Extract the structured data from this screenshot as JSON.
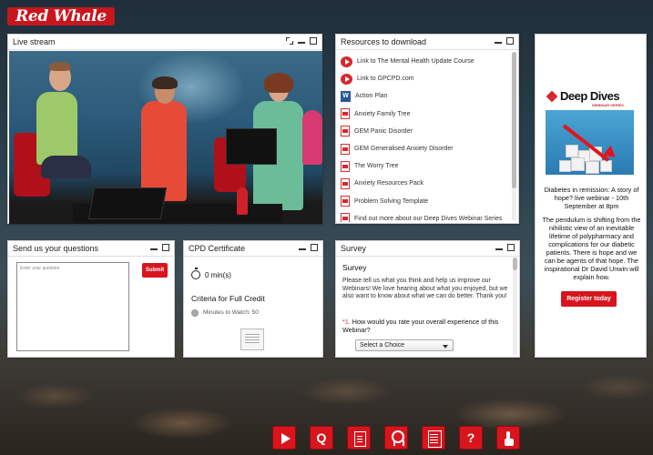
{
  "brand": {
    "logo_text": "Red Whale"
  },
  "live_stream": {
    "title": "Live stream"
  },
  "resources": {
    "title": "Resources to download",
    "items": [
      {
        "label": "Link to The Mental Health Update Course",
        "icon": "video-link-icon"
      },
      {
        "label": "Link to GPCPD.com",
        "icon": "video-link-icon"
      },
      {
        "label": "Action Plan",
        "icon": "word-doc-icon"
      },
      {
        "label": "Anxiety Family Tree",
        "icon": "pdf-icon"
      },
      {
        "label": "GEM Panic Disorder",
        "icon": "pdf-icon"
      },
      {
        "label": "GEM Generalised Anxiety Disorder",
        "icon": "pdf-icon"
      },
      {
        "label": "The Worry Tree",
        "icon": "pdf-icon"
      },
      {
        "label": "Anxiety Resources Pack",
        "icon": "pdf-icon"
      },
      {
        "label": "Problem Solving Template",
        "icon": "pdf-icon"
      },
      {
        "label": "Find out more about our Deep Dives Webinar Series",
        "icon": "pdf-icon"
      }
    ]
  },
  "ad": {
    "logo_text": "Deep Dives",
    "logo_sub": "WEBINAR SERIES",
    "title": "Diabetes in remission: A story of hope? live webinar - 10th September at 8pm",
    "body": "The pendulum is shifting from the nihilistic view of an inevitable lifetime of polypharmacy and complications for our diabetic patients. There is hope and we can be agents of that hope. The inspirational Dr David Unwin will explain how.",
    "button": "Register today"
  },
  "questions": {
    "title": "Send us your questions",
    "placeholder": "Enter your question",
    "submit": "Submit"
  },
  "cpd": {
    "title": "CPD Certificate",
    "minutes": "0 min(s)",
    "criteria": "Criteria for Full Credit",
    "minutes_to_watch": "Minutes to Watch: 50"
  },
  "survey": {
    "title": "Survey",
    "heading": "Survey",
    "intro": "Please tell us what you think and help us improve our Webinars! We love hearing about what you enjoyed, but we also want to know about what we can do better. Thank you!",
    "question_number": "*1.",
    "question": "How would you rate your overall experience of this Webinar?",
    "select_value": "Select a Choice"
  },
  "colors": {
    "brand_red": "#d8151d"
  },
  "toolbar": {
    "search_label": "Q",
    "help_label": "?"
  }
}
